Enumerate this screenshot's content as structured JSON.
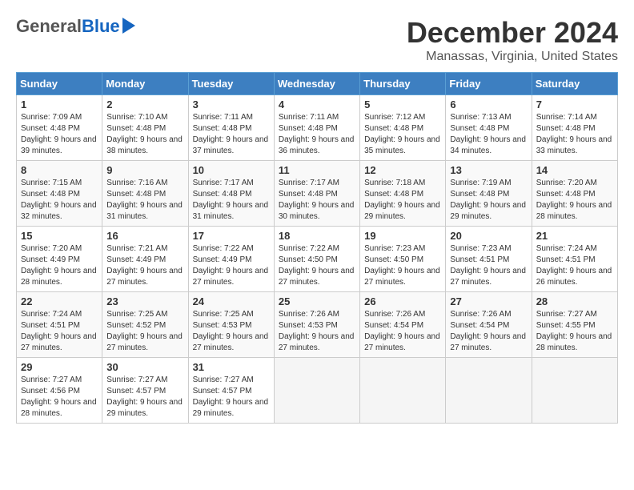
{
  "logo": {
    "general": "General",
    "blue": "Blue"
  },
  "title": "December 2024",
  "subtitle": "Manassas, Virginia, United States",
  "weekdays": [
    "Sunday",
    "Monday",
    "Tuesday",
    "Wednesday",
    "Thursday",
    "Friday",
    "Saturday"
  ],
  "weeks": [
    [
      {
        "day": "1",
        "sunrise": "Sunrise: 7:09 AM",
        "sunset": "Sunset: 4:48 PM",
        "daylight": "Daylight: 9 hours and 39 minutes."
      },
      {
        "day": "2",
        "sunrise": "Sunrise: 7:10 AM",
        "sunset": "Sunset: 4:48 PM",
        "daylight": "Daylight: 9 hours and 38 minutes."
      },
      {
        "day": "3",
        "sunrise": "Sunrise: 7:11 AM",
        "sunset": "Sunset: 4:48 PM",
        "daylight": "Daylight: 9 hours and 37 minutes."
      },
      {
        "day": "4",
        "sunrise": "Sunrise: 7:11 AM",
        "sunset": "Sunset: 4:48 PM",
        "daylight": "Daylight: 9 hours and 36 minutes."
      },
      {
        "day": "5",
        "sunrise": "Sunrise: 7:12 AM",
        "sunset": "Sunset: 4:48 PM",
        "daylight": "Daylight: 9 hours and 35 minutes."
      },
      {
        "day": "6",
        "sunrise": "Sunrise: 7:13 AM",
        "sunset": "Sunset: 4:48 PM",
        "daylight": "Daylight: 9 hours and 34 minutes."
      },
      {
        "day": "7",
        "sunrise": "Sunrise: 7:14 AM",
        "sunset": "Sunset: 4:48 PM",
        "daylight": "Daylight: 9 hours and 33 minutes."
      }
    ],
    [
      {
        "day": "8",
        "sunrise": "Sunrise: 7:15 AM",
        "sunset": "Sunset: 4:48 PM",
        "daylight": "Daylight: 9 hours and 32 minutes."
      },
      {
        "day": "9",
        "sunrise": "Sunrise: 7:16 AM",
        "sunset": "Sunset: 4:48 PM",
        "daylight": "Daylight: 9 hours and 31 minutes."
      },
      {
        "day": "10",
        "sunrise": "Sunrise: 7:17 AM",
        "sunset": "Sunset: 4:48 PM",
        "daylight": "Daylight: 9 hours and 31 minutes."
      },
      {
        "day": "11",
        "sunrise": "Sunrise: 7:17 AM",
        "sunset": "Sunset: 4:48 PM",
        "daylight": "Daylight: 9 hours and 30 minutes."
      },
      {
        "day": "12",
        "sunrise": "Sunrise: 7:18 AM",
        "sunset": "Sunset: 4:48 PM",
        "daylight": "Daylight: 9 hours and 29 minutes."
      },
      {
        "day": "13",
        "sunrise": "Sunrise: 7:19 AM",
        "sunset": "Sunset: 4:48 PM",
        "daylight": "Daylight: 9 hours and 29 minutes."
      },
      {
        "day": "14",
        "sunrise": "Sunrise: 7:20 AM",
        "sunset": "Sunset: 4:48 PM",
        "daylight": "Daylight: 9 hours and 28 minutes."
      }
    ],
    [
      {
        "day": "15",
        "sunrise": "Sunrise: 7:20 AM",
        "sunset": "Sunset: 4:49 PM",
        "daylight": "Daylight: 9 hours and 28 minutes."
      },
      {
        "day": "16",
        "sunrise": "Sunrise: 7:21 AM",
        "sunset": "Sunset: 4:49 PM",
        "daylight": "Daylight: 9 hours and 27 minutes."
      },
      {
        "day": "17",
        "sunrise": "Sunrise: 7:22 AM",
        "sunset": "Sunset: 4:49 PM",
        "daylight": "Daylight: 9 hours and 27 minutes."
      },
      {
        "day": "18",
        "sunrise": "Sunrise: 7:22 AM",
        "sunset": "Sunset: 4:50 PM",
        "daylight": "Daylight: 9 hours and 27 minutes."
      },
      {
        "day": "19",
        "sunrise": "Sunrise: 7:23 AM",
        "sunset": "Sunset: 4:50 PM",
        "daylight": "Daylight: 9 hours and 27 minutes."
      },
      {
        "day": "20",
        "sunrise": "Sunrise: 7:23 AM",
        "sunset": "Sunset: 4:51 PM",
        "daylight": "Daylight: 9 hours and 27 minutes."
      },
      {
        "day": "21",
        "sunrise": "Sunrise: 7:24 AM",
        "sunset": "Sunset: 4:51 PM",
        "daylight": "Daylight: 9 hours and 26 minutes."
      }
    ],
    [
      {
        "day": "22",
        "sunrise": "Sunrise: 7:24 AM",
        "sunset": "Sunset: 4:51 PM",
        "daylight": "Daylight: 9 hours and 27 minutes."
      },
      {
        "day": "23",
        "sunrise": "Sunrise: 7:25 AM",
        "sunset": "Sunset: 4:52 PM",
        "daylight": "Daylight: 9 hours and 27 minutes."
      },
      {
        "day": "24",
        "sunrise": "Sunrise: 7:25 AM",
        "sunset": "Sunset: 4:53 PM",
        "daylight": "Daylight: 9 hours and 27 minutes."
      },
      {
        "day": "25",
        "sunrise": "Sunrise: 7:26 AM",
        "sunset": "Sunset: 4:53 PM",
        "daylight": "Daylight: 9 hours and 27 minutes."
      },
      {
        "day": "26",
        "sunrise": "Sunrise: 7:26 AM",
        "sunset": "Sunset: 4:54 PM",
        "daylight": "Daylight: 9 hours and 27 minutes."
      },
      {
        "day": "27",
        "sunrise": "Sunrise: 7:26 AM",
        "sunset": "Sunset: 4:54 PM",
        "daylight": "Daylight: 9 hours and 27 minutes."
      },
      {
        "day": "28",
        "sunrise": "Sunrise: 7:27 AM",
        "sunset": "Sunset: 4:55 PM",
        "daylight": "Daylight: 9 hours and 28 minutes."
      }
    ],
    [
      {
        "day": "29",
        "sunrise": "Sunrise: 7:27 AM",
        "sunset": "Sunset: 4:56 PM",
        "daylight": "Daylight: 9 hours and 28 minutes."
      },
      {
        "day": "30",
        "sunrise": "Sunrise: 7:27 AM",
        "sunset": "Sunset: 4:57 PM",
        "daylight": "Daylight: 9 hours and 29 minutes."
      },
      {
        "day": "31",
        "sunrise": "Sunrise: 7:27 AM",
        "sunset": "Sunset: 4:57 PM",
        "daylight": "Daylight: 9 hours and 29 minutes."
      },
      null,
      null,
      null,
      null
    ]
  ]
}
